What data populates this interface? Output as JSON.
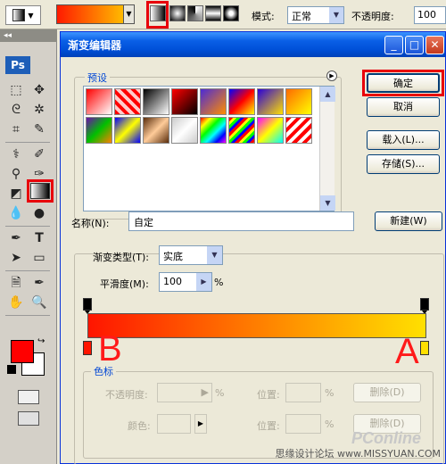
{
  "options_bar": {
    "mode_label": "模式:",
    "mode_value": "正常",
    "opacity_label": "不透明度:",
    "opacity_value": "100"
  },
  "toolbox": {
    "logo": "Ps"
  },
  "dialog": {
    "title": "渐变编辑器",
    "presets_label": "预设",
    "buttons": {
      "ok": "确定",
      "cancel": "取消",
      "load": "载入(L)...",
      "save": "存储(S)...",
      "new": "新建(W)"
    },
    "name_label": "名称(N):",
    "name_value": "自定",
    "gradient_type_label": "渐变类型(T):",
    "gradient_type_value": "实底",
    "smoothness_label": "平滑度(M):",
    "smoothness_value": "100",
    "smoothness_unit": "%",
    "annotation_left": "B",
    "annotation_right": "A",
    "color_stops": {
      "label": "色标",
      "opacity_label": "不透明度:",
      "opacity_unit": "%",
      "location_label": "位置:",
      "location_unit": "%",
      "delete_label": "删除(D)",
      "color_label": "颜色:",
      "location2_label": "位置:",
      "location2_unit": "%",
      "delete2_label": "删除(D)"
    },
    "preset_swatches": [
      "linear-gradient(135deg,#ff0000,#ffffff)",
      "repeating-linear-gradient(45deg,#ff0000 0 4px,#ffcccc 4px 8px)",
      "linear-gradient(135deg,#000,#fff)",
      "linear-gradient(135deg,#ff0000,#000)",
      "linear-gradient(135deg,#4b2bd6,#ff8c00)",
      "linear-gradient(135deg,#0000ff,#ff0000,#ffff00)",
      "linear-gradient(135deg,#2a00d8,#ffe000)",
      "linear-gradient(135deg,#ff6a00,#ffff00)",
      "linear-gradient(135deg,#6a0dad,#00c000,#ff8000)",
      "linear-gradient(135deg,#0000ff,#ffff00,#0000ff)",
      "linear-gradient(135deg,#5a2d0c,#ffcc99,#5a2d0c)",
      "linear-gradient(135deg,#ccc,#fff,#ccc)",
      "linear-gradient(135deg,#ff0000,#ffff00,#00ff00,#00ffff,#0000ff,#ff00ff)",
      "repeating-linear-gradient(135deg,#ff0000 0 3px,#ffff00 3px 6px,#00ff00 6px 9px,#0000ff 9px 12px)",
      "linear-gradient(135deg,#ff00ff,#ffff00,#00ffff)",
      "repeating-linear-gradient(135deg,#ff0000 0 4px,#ffffff 4px 8px)"
    ]
  },
  "watermark": {
    "brand": "PConline",
    "text": "思缘设计论坛 www.MISSYUAN.COM"
  },
  "colors": {
    "highlight_red": "#e8000b",
    "gradient_start": "#ff1500",
    "gradient_end": "#ffe000"
  }
}
